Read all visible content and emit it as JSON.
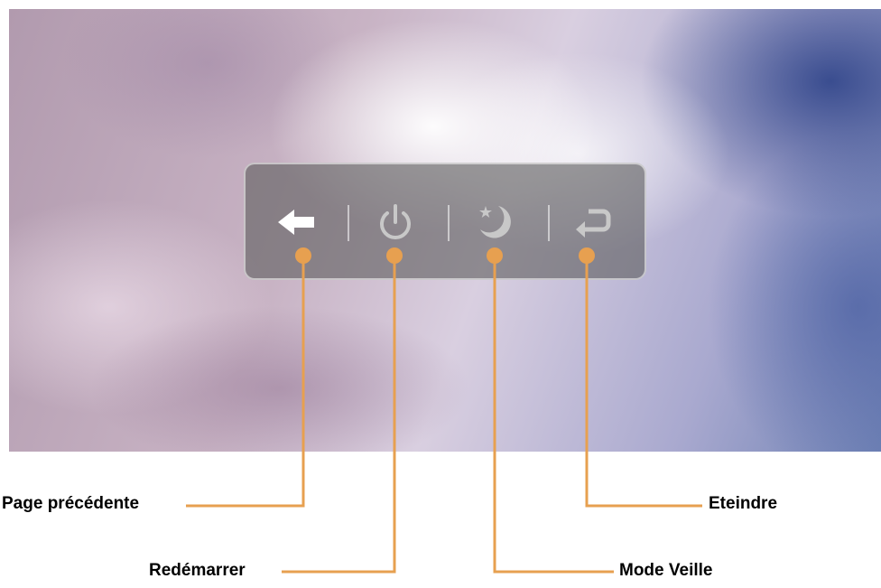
{
  "labels": {
    "back": "Page précédente",
    "restart": "Redémarrer",
    "sleep": "Mode Veille",
    "shutdown": "Eteindre"
  },
  "icons": {
    "back": "back-arrow-icon",
    "restart": "power-icon",
    "sleep": "moon-star-icon",
    "shutdown": "return-arrow-icon"
  },
  "colors": {
    "callout": "#e7a050",
    "panel_background": "#5f5f5f",
    "icon_active": "#ffffff",
    "icon_inactive": "#c8c8c8"
  }
}
